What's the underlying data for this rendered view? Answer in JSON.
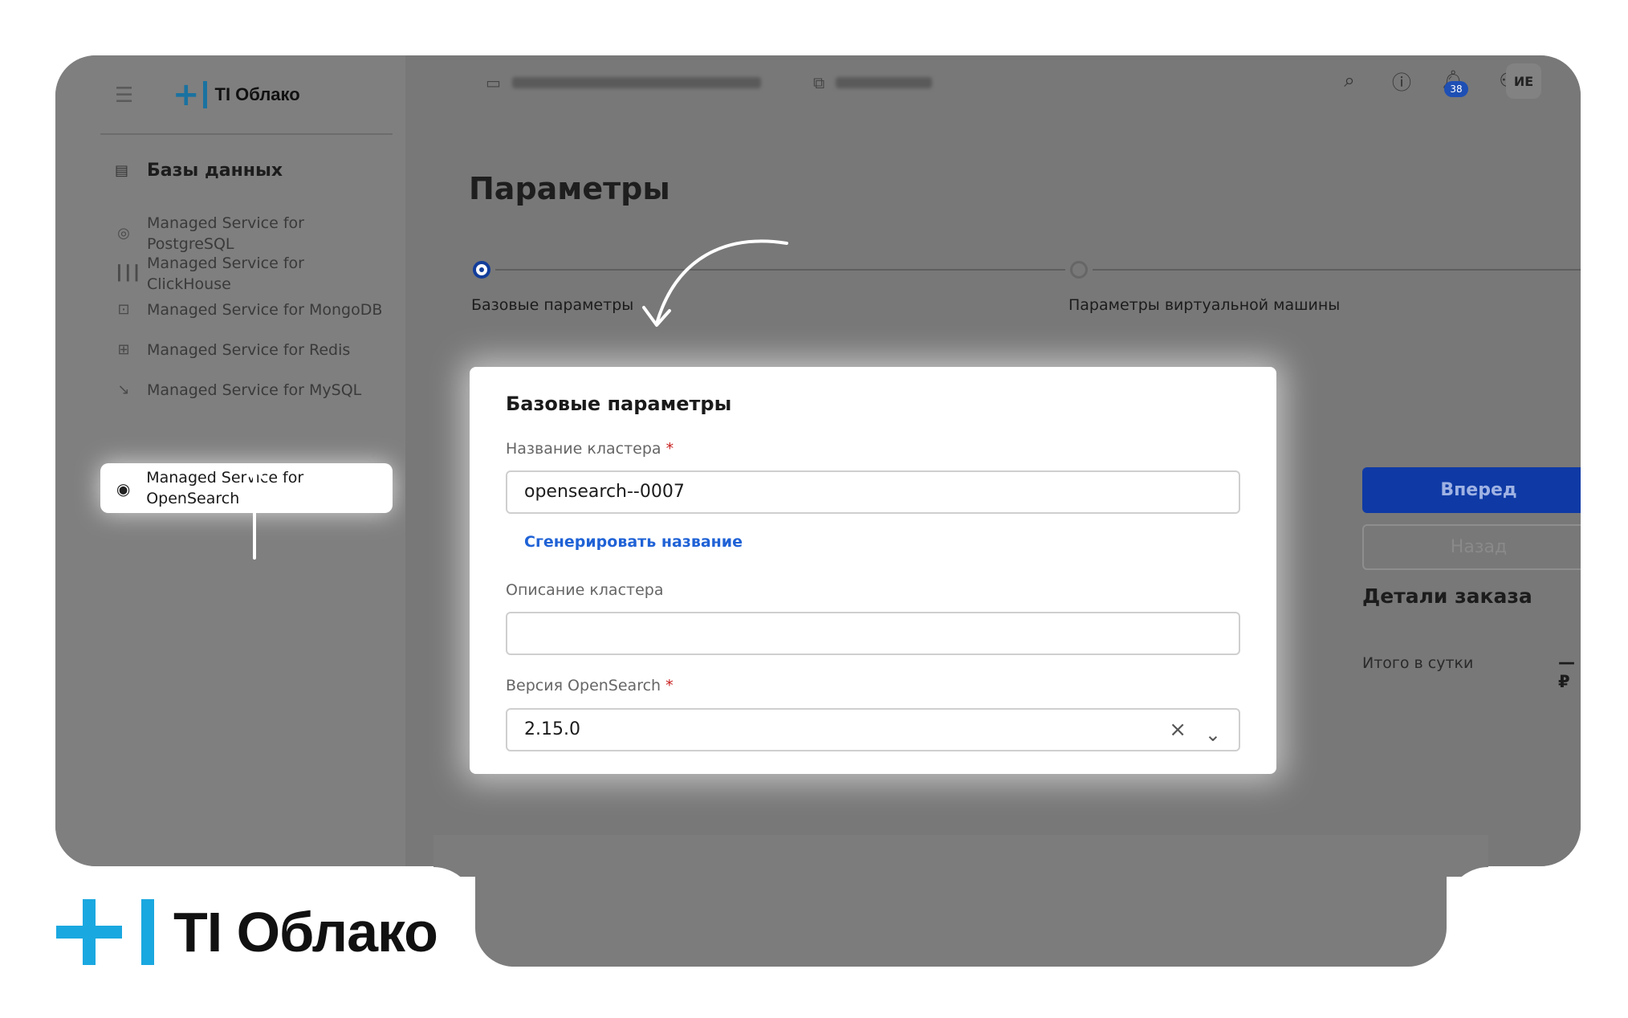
{
  "app": {
    "brand": "TI Облако"
  },
  "sidebar": {
    "section_title": "Базы данных",
    "items": [
      {
        "label": "Managed Service for PostgreSQL",
        "icon": "postgresql-icon"
      },
      {
        "label": "Managed Service for ClickHouse",
        "icon": "clickhouse-icon"
      },
      {
        "label": "Managed Service for MongoDB",
        "icon": "mongodb-icon"
      },
      {
        "label": "Managed Service for Redis",
        "icon": "redis-icon"
      },
      {
        "label": "Managed Service for MySQL",
        "icon": "mysql-icon"
      },
      {
        "label": "Managed Service for OpenSearch",
        "icon": "opensearch-icon",
        "active": true
      }
    ]
  },
  "topbar": {
    "notifications_count": "38",
    "user_initials": "ИЕ"
  },
  "page": {
    "title": "Параметры",
    "steps": [
      {
        "label": "Базовые параметры",
        "active": true
      },
      {
        "label": "Параметры виртуальной машины",
        "active": false
      }
    ]
  },
  "form": {
    "title": "Базовые параметры",
    "cluster_name_label": "Название кластера",
    "cluster_name_value": "opensearch--0007",
    "generate_link": "Сгенерировать название",
    "description_label": "Описание кластера",
    "description_value": "",
    "version_label": "Версия OpenSearch",
    "version_value": "2.15.0",
    "required_mark": "*"
  },
  "order": {
    "next_button": "Вперед",
    "back_button": "Назад",
    "title": "Детали заказа",
    "total_label": "Итого в сутки",
    "total_value": "— ₽"
  },
  "colors": {
    "accent": "#0f3aa5",
    "brand": "#1aa8e0",
    "link": "#1f62d6",
    "required": "#c81e1e"
  }
}
